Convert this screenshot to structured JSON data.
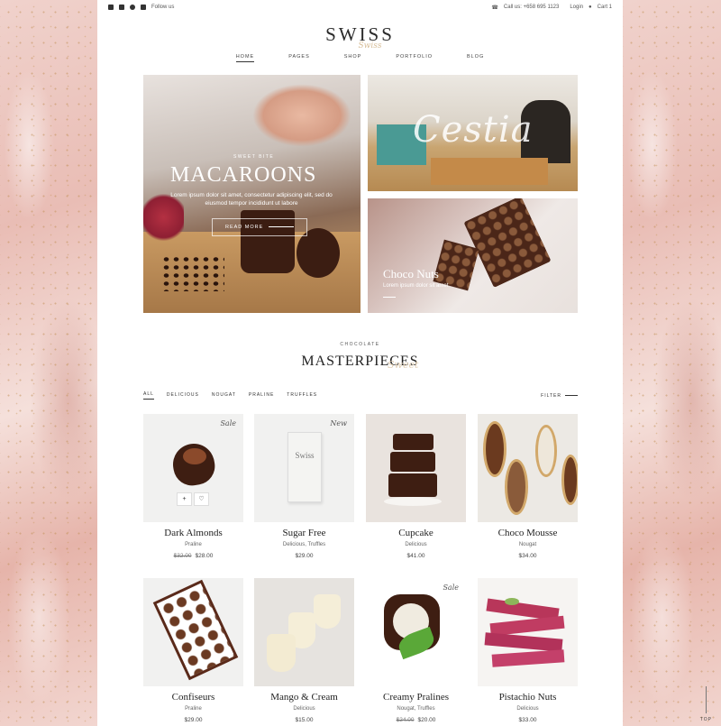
{
  "topbar": {
    "follow": "Follow us",
    "phone": "Call us: +658 695 1123",
    "login": "Login",
    "cart": "Cart 1",
    "social_icons": [
      "facebook-icon",
      "twitter-icon",
      "pinterest-icon",
      "youtube-icon"
    ]
  },
  "logo": {
    "text": "SWISS",
    "script": "Swiss"
  },
  "nav": {
    "items": [
      "HOME",
      "PAGES",
      "SHOP",
      "PORTFOLIO",
      "BLOG"
    ],
    "active": "HOME"
  },
  "hero": {
    "main": {
      "eyebrow": "SWEET BITE",
      "title": "MACAROONS",
      "desc": "Lorem ipsum dolor sit amet, consectetur adipiscing elit, sed do eiusmod tempor incididunt ut labore",
      "button": "READ MORE"
    },
    "top_right": {
      "script": "Cestia"
    },
    "bottom_right": {
      "title": "Choco Nuts",
      "desc": "Lorem ipsum dolor sit amet"
    }
  },
  "section": {
    "eyebrow": "CHOCOLATE",
    "title": "MASTERPIECES",
    "script": "Sweet"
  },
  "filters": {
    "items": [
      "ALL",
      "DELICIOUS",
      "NOUGAT",
      "PRALINE",
      "TRUFFLES"
    ],
    "active": "ALL",
    "filter_label": "FILTER"
  },
  "products": [
    {
      "name": "Dark Almonds",
      "cat": "Praline",
      "old_price": "$32.00",
      "price": "$28.00",
      "badge": "Sale"
    },
    {
      "name": "Sugar Free",
      "cat": "Delicious,  Truffles",
      "old_price": "",
      "price": "$29.00",
      "badge": "New"
    },
    {
      "name": "Cupcake",
      "cat": "Delicious",
      "old_price": "",
      "price": "$41.00",
      "badge": ""
    },
    {
      "name": "Choco Mousse",
      "cat": "Nougat",
      "old_price": "",
      "price": "$34.00",
      "badge": ""
    },
    {
      "name": "Confiseurs",
      "cat": "Praline",
      "old_price": "",
      "price": "$29.00",
      "badge": ""
    },
    {
      "name": "Mango & Cream",
      "cat": "Delicious",
      "old_price": "",
      "price": "$15.00",
      "badge": ""
    },
    {
      "name": "Creamy Pralines",
      "cat": "Nougat,  Truffles",
      "old_price": "$24.00",
      "price": "$20.00",
      "badge": "Sale"
    },
    {
      "name": "Pistachio Nuts",
      "cat": "Delicious",
      "old_price": "",
      "price": "$33.00",
      "badge": ""
    }
  ],
  "wrapper_label": "Swiss",
  "to_top": "TOP"
}
